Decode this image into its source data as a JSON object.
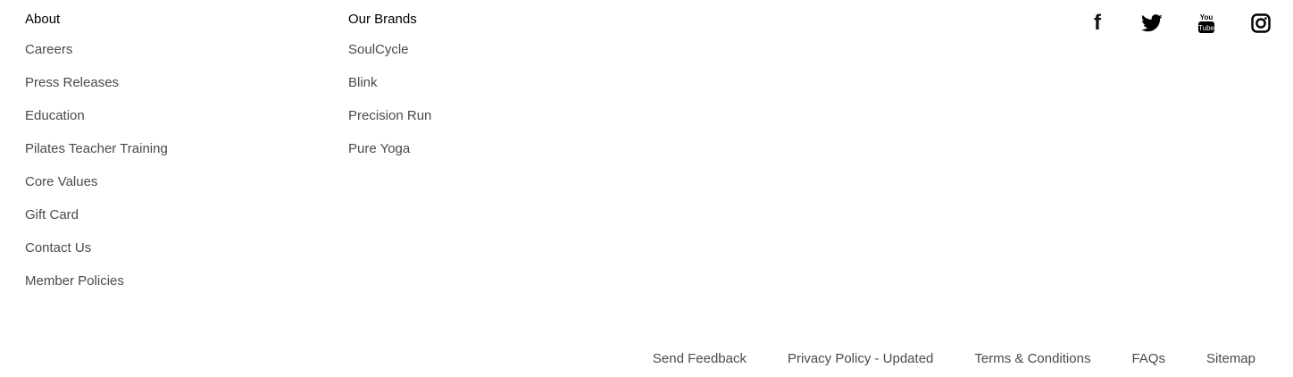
{
  "about": {
    "title": "About",
    "links": [
      "Careers",
      "Press Releases",
      "Education",
      "Pilates Teacher Training",
      "Core Values",
      "Gift Card",
      "Contact Us",
      "Member Policies"
    ]
  },
  "brands": {
    "title": "Our Brands",
    "links": [
      "SoulCycle",
      "Blink",
      "Precision Run",
      "Pure Yoga"
    ]
  },
  "social": {
    "icons": [
      "facebook-icon",
      "twitter-icon",
      "youtube-icon",
      "instagram-icon"
    ],
    "facebook_glyph": "f",
    "youtube_top": "You",
    "youtube_bottom": "Tube"
  },
  "bottom": {
    "links": [
      "Send Feedback",
      "Privacy Policy - Updated",
      "Terms & Conditions",
      "FAQs",
      "Sitemap"
    ]
  },
  "colors": {
    "heading": "#000000",
    "link": "#4a4a4a",
    "background": "#ffffff"
  }
}
